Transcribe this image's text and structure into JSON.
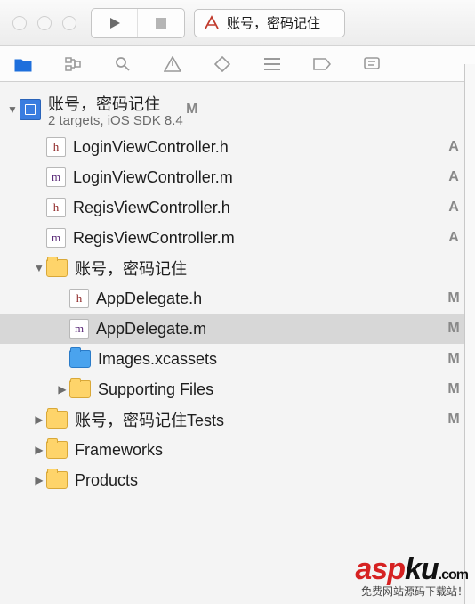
{
  "scheme": {
    "name": "账号，密码记住"
  },
  "project": {
    "name": "账号，密码记住",
    "subtitle": "2 targets, iOS SDK 8.4",
    "badge": "M"
  },
  "tree": [
    {
      "kind": "file",
      "icon": "h",
      "name": "LoginViewController.h",
      "badge": "A",
      "indent": 1
    },
    {
      "kind": "file",
      "icon": "m",
      "name": "LoginViewController.m",
      "badge": "A",
      "indent": 1
    },
    {
      "kind": "file",
      "icon": "h",
      "name": "RegisViewController.h",
      "badge": "A",
      "indent": 1
    },
    {
      "kind": "file",
      "icon": "m",
      "name": "RegisViewController.m",
      "badge": "A",
      "indent": 1
    },
    {
      "kind": "folder",
      "name": "账号，密码记住",
      "badge": "",
      "indent": 1,
      "open": true
    },
    {
      "kind": "file",
      "icon": "h",
      "name": "AppDelegate.h",
      "badge": "M",
      "indent": 2
    },
    {
      "kind": "file",
      "icon": "m",
      "name": "AppDelegate.m",
      "badge": "M",
      "indent": 2,
      "selected": true
    },
    {
      "kind": "assets",
      "name": "Images.xcassets",
      "badge": "M",
      "indent": 2
    },
    {
      "kind": "folder",
      "name": "Supporting Files",
      "badge": "M",
      "indent": 2,
      "open": false
    },
    {
      "kind": "folder",
      "name": "账号，密码记住Tests",
      "badge": "M",
      "indent": 1,
      "open": false
    },
    {
      "kind": "folder",
      "name": "Frameworks",
      "badge": "",
      "indent": 1,
      "open": false
    },
    {
      "kind": "folder",
      "name": "Products",
      "badge": "",
      "indent": 1,
      "open": false
    }
  ],
  "watermark": {
    "brand_red": "asp",
    "brand_black": "ku",
    "suffix": ".com",
    "tagline": "免费网站源码下载站！"
  }
}
